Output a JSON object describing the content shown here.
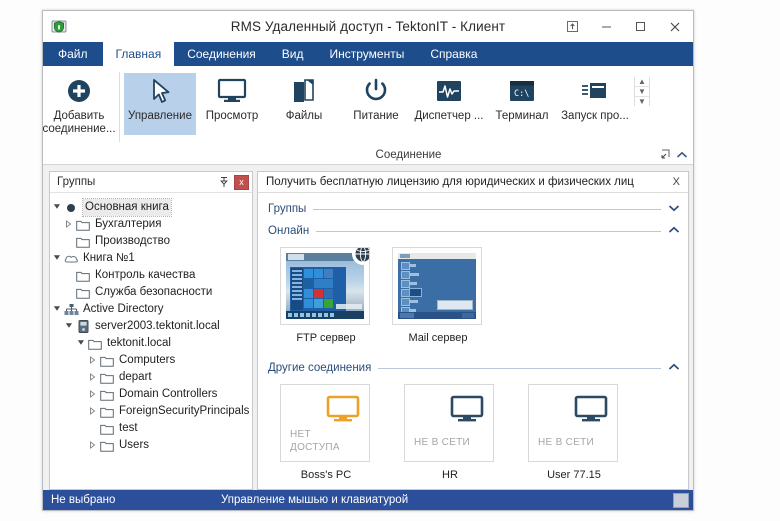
{
  "window": {
    "title": "RMS Удаленный доступ - TektonIT - Клиент",
    "app_icon": "shield-monitor-icon",
    "controls": {
      "ribbon_options": "ribbon-display-options-icon",
      "minimize": "minimize-icon",
      "maximize": "maximize-icon",
      "close": "close-icon"
    }
  },
  "tabs": [
    {
      "label": "Файл",
      "kind": "file"
    },
    {
      "label": "Главная",
      "kind": "active"
    },
    {
      "label": "Соединения",
      "kind": "normal"
    },
    {
      "label": "Вид",
      "kind": "normal"
    },
    {
      "label": "Инструменты",
      "kind": "normal"
    },
    {
      "label": "Справка",
      "kind": "normal"
    }
  ],
  "ribbon": {
    "add_connection": {
      "label": "Добавить\nсоединение...",
      "icon": "plus-circle-icon"
    },
    "group_caption": "Соединение",
    "buttons": [
      {
        "label": "Управление",
        "icon": "mouse-cursor-icon",
        "selected": true
      },
      {
        "label": "Просмотр",
        "icon": "monitor-icon",
        "selected": false
      },
      {
        "label": "Файлы",
        "icon": "files-icon",
        "selected": false
      },
      {
        "label": "Питание",
        "icon": "power-icon",
        "selected": false
      },
      {
        "label": "Диспетчер ...",
        "icon": "task-manager-icon",
        "selected": false
      },
      {
        "label": "Терминал",
        "icon": "terminal-icon",
        "selected": false
      },
      {
        "label": "Запуск про...",
        "icon": "run-program-icon",
        "selected": false
      }
    ],
    "scroll": {
      "up": "▲",
      "down": "▼",
      "more": "▼"
    },
    "dialog_launcher": "dialog-launcher-icon",
    "collapse": "collapse-ribbon-chevron-icon"
  },
  "sidebar": {
    "title": "Группы",
    "pin_icon": "pin-icon",
    "close_label": "x",
    "tree": [
      {
        "label": "Основная книга",
        "depth": 0,
        "icon": "filled-circle-icon",
        "expander": "open",
        "selected": true
      },
      {
        "label": "Бухгалтерия",
        "depth": 1,
        "icon": "folder-icon",
        "expander": "closed",
        "selected": false
      },
      {
        "label": "Производство",
        "depth": 1,
        "icon": "folder-icon",
        "expander": "leaf",
        "selected": false
      },
      {
        "label": "Книга №1",
        "depth": 0,
        "icon": "cloud-icon",
        "expander": "open",
        "selected": false
      },
      {
        "label": "Контроль качества",
        "depth": 1,
        "icon": "folder-icon",
        "expander": "leaf",
        "selected": false
      },
      {
        "label": "Служба безопасности",
        "depth": 1,
        "icon": "folder-icon",
        "expander": "leaf",
        "selected": false
      },
      {
        "label": "Active Directory",
        "depth": 0,
        "icon": "network-icon",
        "expander": "open",
        "selected": false
      },
      {
        "label": "server2003.tektonit.local",
        "depth": 1,
        "icon": "server-icon",
        "expander": "open",
        "selected": false
      },
      {
        "label": "tektonit.local",
        "depth": 2,
        "icon": "folder-icon",
        "expander": "open",
        "selected": false
      },
      {
        "label": "Computers",
        "depth": 3,
        "icon": "folder-icon",
        "expander": "closed",
        "selected": false
      },
      {
        "label": "depart",
        "depth": 3,
        "icon": "folder-icon",
        "expander": "closed",
        "selected": false
      },
      {
        "label": "Domain Controllers",
        "depth": 3,
        "icon": "folder-icon",
        "expander": "closed",
        "selected": false
      },
      {
        "label": "ForeignSecurityPrincipals",
        "depth": 3,
        "icon": "folder-icon",
        "expander": "closed",
        "selected": false
      },
      {
        "label": "test",
        "depth": 3,
        "icon": "folder-icon",
        "expander": "leaf",
        "selected": false
      },
      {
        "label": "Users",
        "depth": 3,
        "icon": "folder-icon",
        "expander": "closed",
        "selected": false
      }
    ]
  },
  "main": {
    "license_banner": {
      "text": "Получить бесплатную лицензию для юридических и физических лиц",
      "close_label": "X"
    },
    "sections": [
      {
        "title": "Группы",
        "state": "collapsed",
        "chevron": "˅"
      },
      {
        "title": "Онлайн",
        "state": "expanded",
        "chevron": "˄"
      },
      {
        "title": "Другие соединения",
        "state": "expanded",
        "chevron": "˄"
      }
    ],
    "online_tiles": [
      {
        "caption": "FTP сервер",
        "thumb": "windows10-desktop-thumbnail",
        "badge": "globe-icon"
      },
      {
        "caption": "Mail сервер",
        "thumb": "windows-server-2003-desktop-thumbnail",
        "badge": ""
      }
    ],
    "other_tiles": [
      {
        "caption": "Boss's PC",
        "status": "НЕТ\nДОСТУПА",
        "icon": "monitor-icon",
        "icon_color": "#eda12a"
      },
      {
        "caption": "HR",
        "status": "НЕ В СЕТИ",
        "icon": "monitor-icon",
        "icon_color": "#2c4a63"
      },
      {
        "caption": "User 77.15",
        "status": "НЕ В СЕТИ",
        "icon": "monitor-icon",
        "icon_color": "#2c4a63"
      }
    ]
  },
  "statusbar": {
    "selection": "Не выбрано",
    "mode": "Управление мышью и клавиатурой",
    "indicator_icon": "display-indicator-icon"
  },
  "colors": {
    "ribbon_blue": "#1e4d8c",
    "status_blue": "#2b4f9b",
    "selected_tile": "#b8d0ea",
    "section_title": "#2a4d7a",
    "accent_orange": "#eda12a",
    "icon_dark": "#2c4a63",
    "close_red": "#c0504d"
  }
}
